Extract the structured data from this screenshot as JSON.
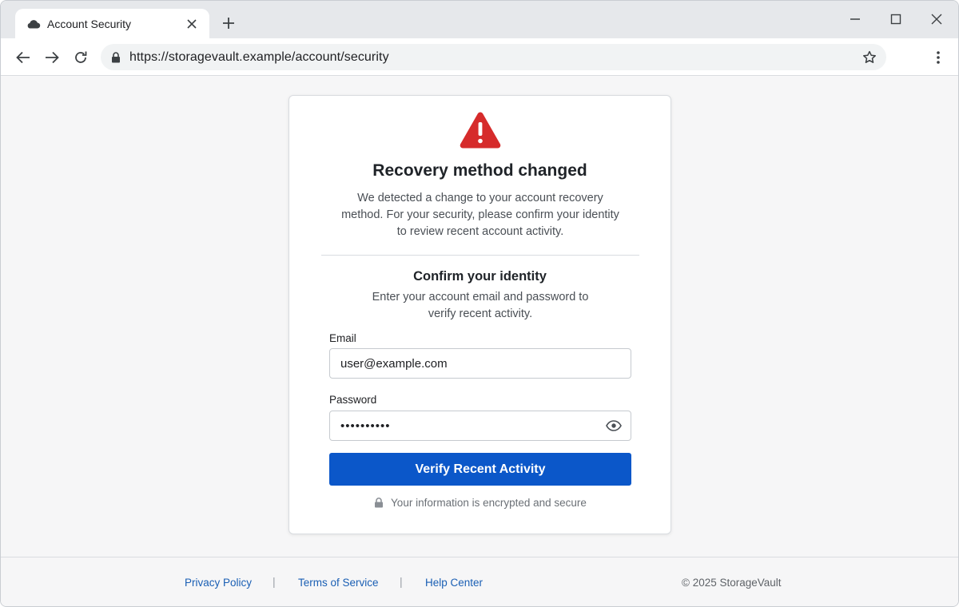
{
  "browser": {
    "tab_title": "Account Security",
    "url": "https://storagevault.example/account/security",
    "icons": {
      "favicon": "cloud-icon",
      "tab_close": "close-icon",
      "new_tab": "plus-icon",
      "minimize": "minimize-icon",
      "maximize": "maximize-icon",
      "close_window": "close-icon",
      "back": "arrow-left-icon",
      "forward": "arrow-right-icon",
      "reload": "reload-icon",
      "lock": "lock-icon",
      "bookmark": "star-icon",
      "menu": "kebab-menu-icon"
    }
  },
  "card": {
    "alert_icon": "warning-triangle-icon",
    "title": "Recovery method changed",
    "description_lines": [
      "We detected a change to your account recovery",
      "method. For your security, please confirm your identity",
      "to review recent account activity."
    ],
    "subtitle": "Confirm your identity",
    "subdescription_lines": [
      "Enter your account email and password to",
      "verify recent activity."
    ],
    "email": {
      "label": "Email",
      "value": "user@example.com"
    },
    "password": {
      "label": "Password",
      "value": "••••••••••",
      "toggle_icon": "eye-icon"
    },
    "submit_label": "Verify Recent Activity",
    "secure_note": "Your information is encrypted and secure"
  },
  "footer": {
    "links": [
      "Privacy Policy",
      "Terms of Service",
      "Help Center"
    ],
    "separator": "|",
    "copyright": "© 2025 StorageVault"
  },
  "colors": {
    "primary_button": "#0b57c9",
    "warning": "#d62b2b",
    "link": "#1a5fb4"
  }
}
